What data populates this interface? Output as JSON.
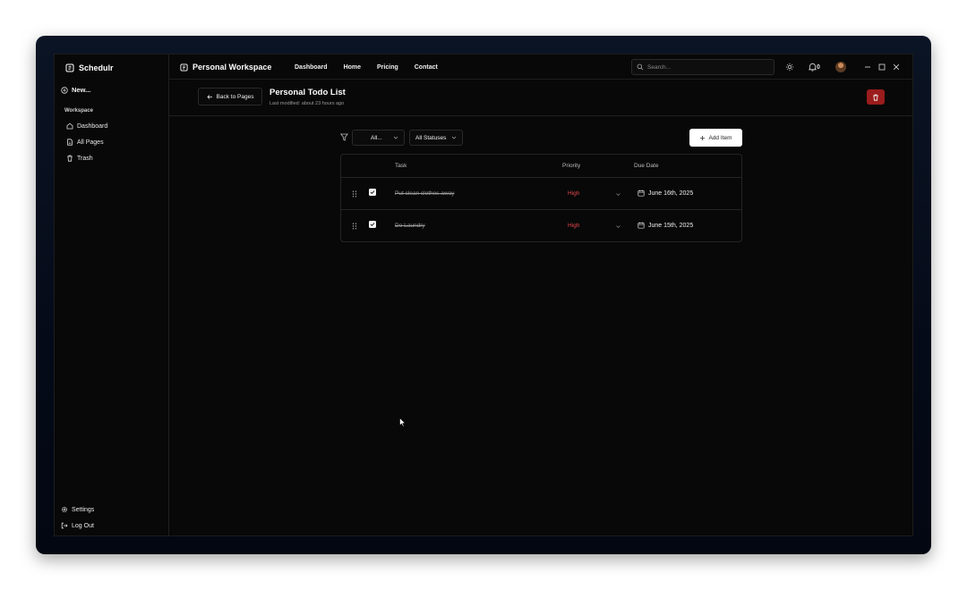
{
  "app": {
    "brand": "Schedulr"
  },
  "sidebar": {
    "new_label": "New...",
    "section_label": "Workspace",
    "items": [
      {
        "label": "Dashboard",
        "icon": "home-icon"
      },
      {
        "label": "All Pages",
        "icon": "file-icon"
      },
      {
        "label": "Trash",
        "icon": "trash-icon"
      }
    ],
    "bottom": [
      {
        "label": "Settings",
        "icon": "gear-icon"
      },
      {
        "label": "Log Out",
        "icon": "logout-icon"
      }
    ]
  },
  "topbar": {
    "workspace_title": "Personal Workspace",
    "nav": [
      "Dashboard",
      "Home",
      "Pricing",
      "Contact"
    ],
    "search_placeholder": "Search...",
    "notifications_count": "0"
  },
  "page": {
    "back_label": "Back to Pages",
    "title": "Personal Todo List",
    "subtitle": "Last modified: about 23 hours ago"
  },
  "toolbar": {
    "priority_filter": "All...",
    "status_filter": "All Statuses",
    "add_label": "Add Item"
  },
  "table": {
    "headers": {
      "task": "Task",
      "priority": "Priority",
      "due": "Due Date"
    },
    "rows": [
      {
        "task": "Put clean clothes away",
        "priority": "High",
        "due": "June 16th, 2025",
        "done": true
      },
      {
        "task": "Do Laundry",
        "priority": "High",
        "due": "June 15th, 2025",
        "done": true
      }
    ]
  },
  "colors": {
    "accent_danger": "#9b1c1c",
    "priority_high": "#e5484d",
    "background": "#080808"
  }
}
